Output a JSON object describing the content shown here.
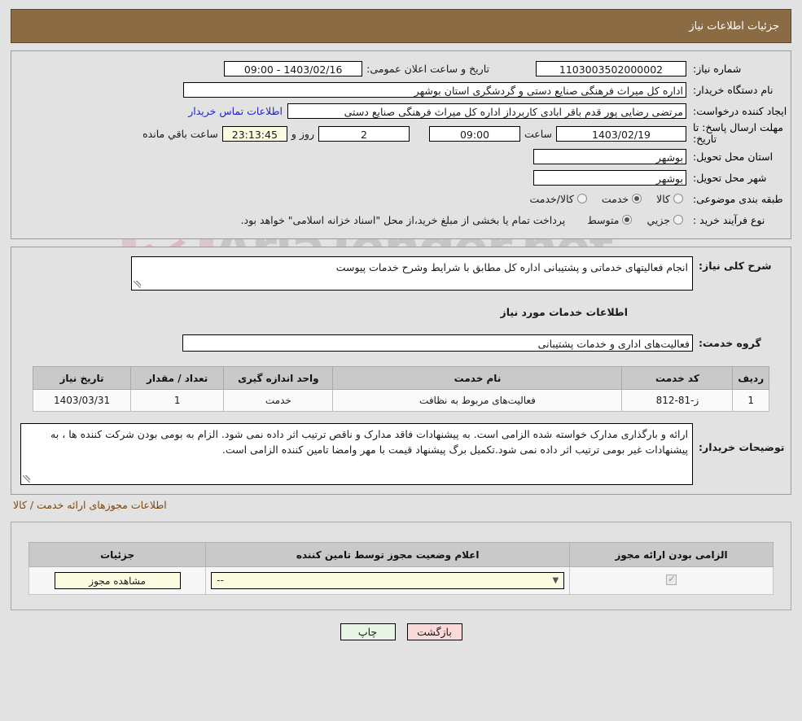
{
  "header": {
    "title": "جزئیات اطلاعات نیاز"
  },
  "watermark": {
    "text": "AriaTender.net"
  },
  "form": {
    "need_number_label": "شماره نیاز:",
    "need_number_value": "1103003502000002",
    "announce_label": "تاریخ و ساعت اعلان عمومی:",
    "announce_value": "1403/02/16 - 09:00",
    "buyer_org_label": "نام دستگاه خریدار:",
    "buyer_org_value": "اداره کل میراث فرهنگی  صنایع دستی و گردشگری استان بوشهر",
    "creator_label": "ایجاد کننده درخواست:",
    "creator_value": "مرتضی رضایی پور قدم باقر ابادی کاربرداز اداره کل میراث فرهنگی  صنایع دستی",
    "contact_link": "اطلاعات تماس خریدار",
    "deadline_label": "مهلت ارسال پاسخ: تا تاریخ:",
    "deadline_date": "1403/02/19",
    "deadline_time_label": "ساعت",
    "deadline_time": "09:00",
    "remaining_days": "2",
    "remaining_days_label": "روز و",
    "remaining_clock": "23:13:45",
    "remaining_clock_label": "ساعت باقي مانده",
    "province_label": "استان محل تحویل:",
    "province_value": "بوشهر",
    "city_label": "شهر محل تحویل:",
    "city_value": "بوشهر",
    "category_label": "طبقه بندی موضوعی:",
    "category_options": [
      {
        "label": "کالا",
        "selected": false
      },
      {
        "label": "خدمت",
        "selected": true
      },
      {
        "label": "کالا/خدمت",
        "selected": false
      }
    ],
    "process_label": "نوع فرآیند خرید :",
    "process_options": [
      {
        "label": "جزیي",
        "selected": false
      },
      {
        "label": "متوسط",
        "selected": true
      }
    ],
    "treasury_note": "پرداخت تمام یا بخشی از مبلغ خرید،از محل \"اسناد خزانه اسلامی\" خواهد بود."
  },
  "description": {
    "general_label": "شرح کلی نیاز:",
    "general_value": "انجام فعالیتهای خدماتی و پشتیبانی اداره کل مطابق با شرایط وشرح خدمات پیوست",
    "services_header": "اطلاعات خدمات مورد نیاز",
    "service_group_label": "گروه خدمت:",
    "service_group_value": "فعالیت‌های اداری و خدمات پشتیبانی"
  },
  "items_table": {
    "columns": [
      "ردیف",
      "کد خدمت",
      "نام خدمت",
      "واحد اندازه گیری",
      "تعداد / مقدار",
      "تاریخ نیاز"
    ],
    "rows": [
      {
        "row_no": "1",
        "service_code": "ز-81-812",
        "service_name": "فعالیت‌های مربوط به نظافت",
        "unit": "خدمت",
        "quantity": "1",
        "need_date": "1403/03/31"
      }
    ]
  },
  "buyer_notes": {
    "label": "توضیحات خریدار:",
    "value": "ارائه و بارگذاری مدارک خواسته شده الزامی است. به پیشنهادات فاقد مدارک و ناقص ترتیب اثر داده نمی شود. الزام به بومی بودن شرکت کننده ها ، به پیشنهادات غیر بومی ترتیب اثر داده نمی شود.تکمیل برگ پیشنهاد قیمت با مهر وامضا تامین کننده الزامی است."
  },
  "permits": {
    "caption": "اطلاعات مجوزهای ارائه خدمت / کالا",
    "columns": [
      "الزامی بودن ارائه مجوز",
      "اعلام وضعیت مجوز توسط تامین کننده",
      "جزئیات"
    ],
    "rows": [
      {
        "required_checked": true,
        "status_value": "--",
        "details_button": "مشاهده مجوز"
      }
    ]
  },
  "footer": {
    "print_label": "چاپ",
    "back_label": "بازگشت"
  },
  "colors": {
    "header_bar": "#8a6b44",
    "page_bg": "#e2e2e2",
    "link": "#2222cc",
    "caption": "#7a4a12",
    "print_btn": "#e6f5e4",
    "back_btn": "#fbd9d9",
    "field_yellow": "#fbfbe2"
  }
}
